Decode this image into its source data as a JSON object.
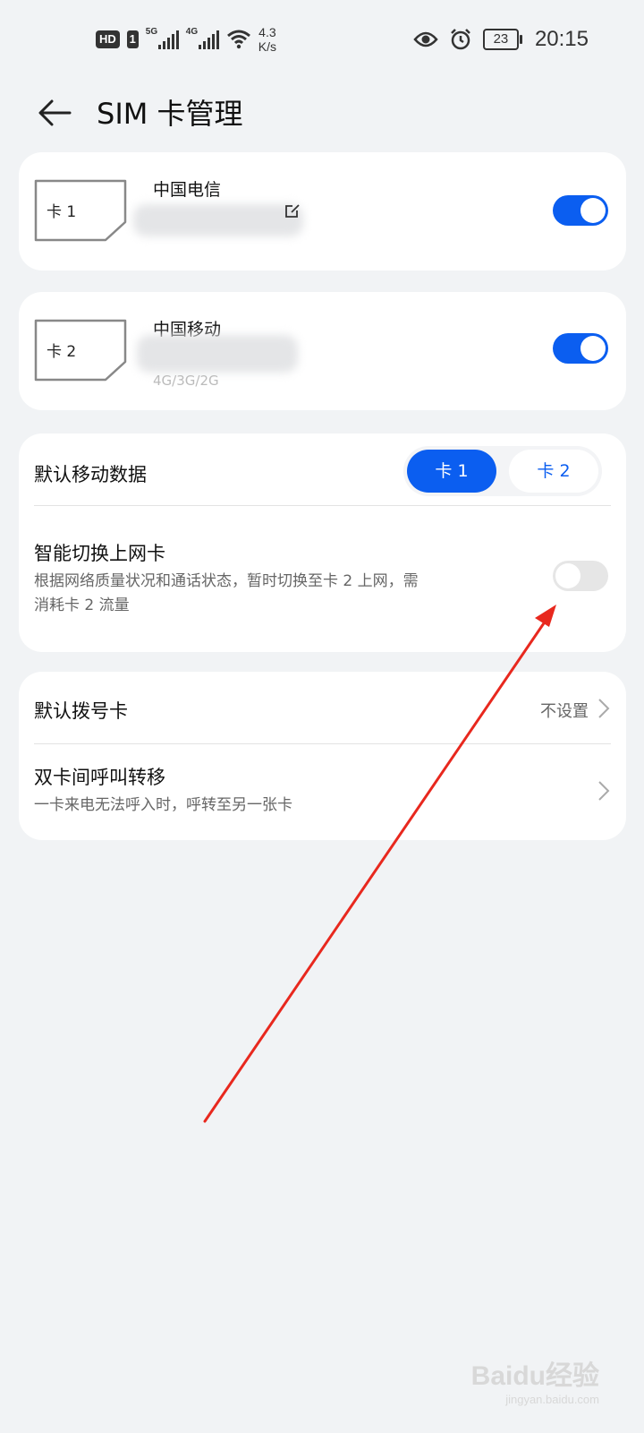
{
  "status": {
    "hd": "HD",
    "sim1": "1",
    "net1": "5G",
    "net2": "4G",
    "speed_value": "4.3",
    "speed_unit": "K/s",
    "battery": "23",
    "time": "20:15"
  },
  "header": {
    "title": "SIM 卡管理"
  },
  "sim_cards": [
    {
      "icon_label": "卡 1",
      "carrier": "中国电信",
      "enabled": true
    },
    {
      "icon_label": "卡 2",
      "carrier": "中国移动",
      "network": "4G/3G/2G",
      "enabled": true
    }
  ],
  "data_section": {
    "default_data_label": "默认移动数据",
    "options": [
      "卡 1",
      "卡 2"
    ],
    "selected": "卡 1",
    "smart_switch_title": "智能切换上网卡",
    "smart_switch_desc_line1": "根据网络质量状况和通话状态，暂时切换至卡 2 上网，需",
    "smart_switch_desc_line2": "消耗卡 2 流量",
    "smart_switch_enabled": false
  },
  "call_section": {
    "default_dial_label": "默认拨号卡",
    "default_dial_value": "不设置",
    "forward_title": "双卡间呼叫转移",
    "forward_desc": "一卡来电无法呼入时，呼转至另一张卡"
  },
  "watermark": {
    "brand": "Baidu经验",
    "url": "jingyan.baidu.com"
  },
  "colors": {
    "accent": "#0b5ef0",
    "annotation": "#e8281e",
    "background": "#f1f3f5"
  }
}
